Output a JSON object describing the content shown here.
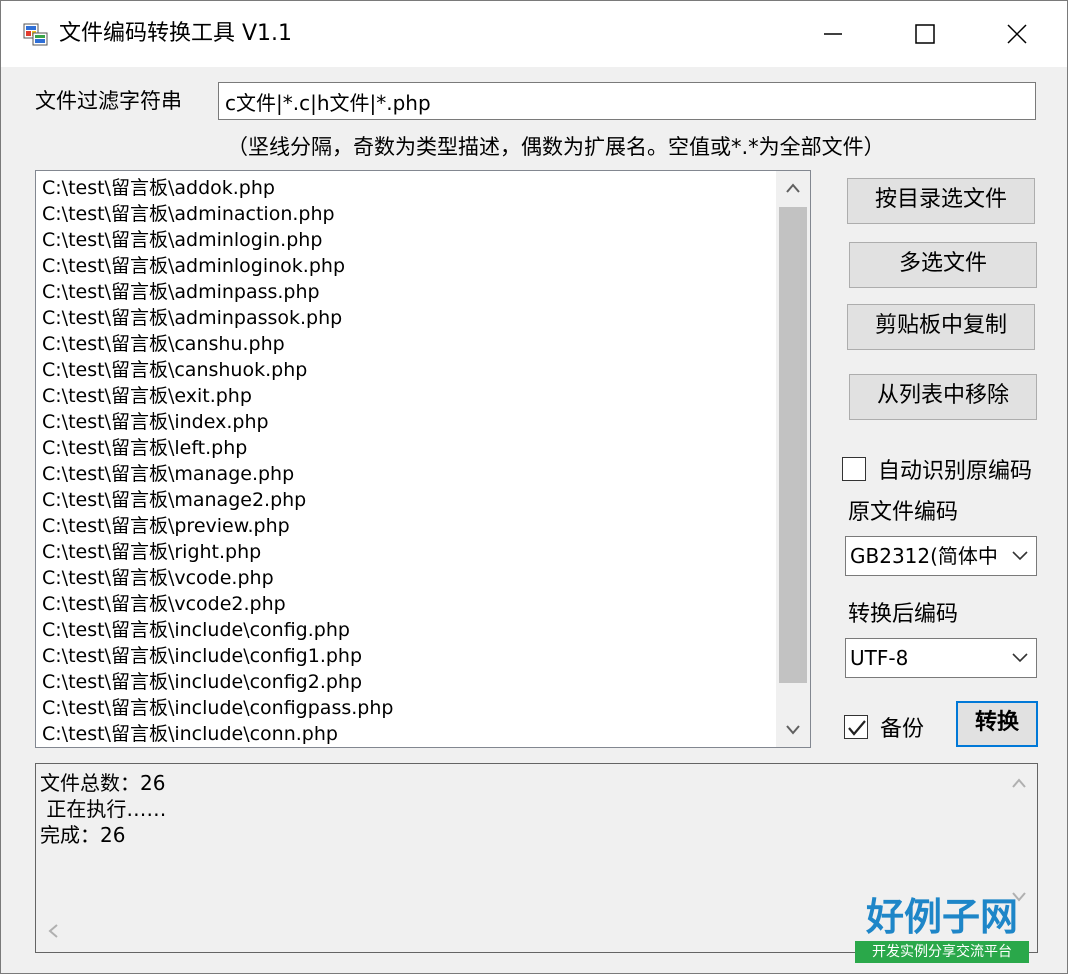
{
  "window": {
    "title": "文件编码转换工具 V1.1"
  },
  "filter": {
    "label": "文件过滤字符串",
    "value": "c文件|*.c|h文件|*.php"
  },
  "hint": "（坚线分隔，奇数为类型描述，偶数为扩展名。空值或*.*为全部文件）",
  "file_list": [
    "C:\\test\\留言板\\addok.php",
    "C:\\test\\留言板\\adminaction.php",
    "C:\\test\\留言板\\adminlogin.php",
    "C:\\test\\留言板\\adminloginok.php",
    "C:\\test\\留言板\\adminpass.php",
    "C:\\test\\留言板\\adminpassok.php",
    "C:\\test\\留言板\\canshu.php",
    "C:\\test\\留言板\\canshuok.php",
    "C:\\test\\留言板\\exit.php",
    "C:\\test\\留言板\\index.php",
    "C:\\test\\留言板\\left.php",
    "C:\\test\\留言板\\manage.php",
    "C:\\test\\留言板\\manage2.php",
    "C:\\test\\留言板\\preview.php",
    "C:\\test\\留言板\\right.php",
    "C:\\test\\留言板\\vcode.php",
    "C:\\test\\留言板\\vcode2.php",
    "C:\\test\\留言板\\include\\config.php",
    "C:\\test\\留言板\\include\\config1.php",
    "C:\\test\\留言板\\include\\config2.php",
    "C:\\test\\留言板\\include\\configpass.php",
    "C:\\test\\留言板\\include\\conn.php"
  ],
  "buttons": {
    "select_dir": "按目录选文件",
    "multi_select": "多选文件",
    "paste_clipboard": "剪贴板中复制",
    "remove": "从列表中移除",
    "convert": "转换"
  },
  "auto_detect": {
    "label": "自动识别原编码",
    "checked": false
  },
  "source_encoding": {
    "label": "原文件编码",
    "value": "GB2312(简体中"
  },
  "target_encoding": {
    "label": "转换后编码",
    "value": "UTF-8"
  },
  "backup": {
    "label": "备份",
    "checked": true
  },
  "log": [
    "文件总数：26",
    " 正在执行……",
    "完成：26"
  ],
  "watermark": {
    "title": "好例子网",
    "subtitle": "开发实例分享交流平台"
  },
  "colors": {
    "accent": "#0078d7",
    "window_bg": "#f0f0f0",
    "scroll_thumb": "#c2c2c2"
  }
}
